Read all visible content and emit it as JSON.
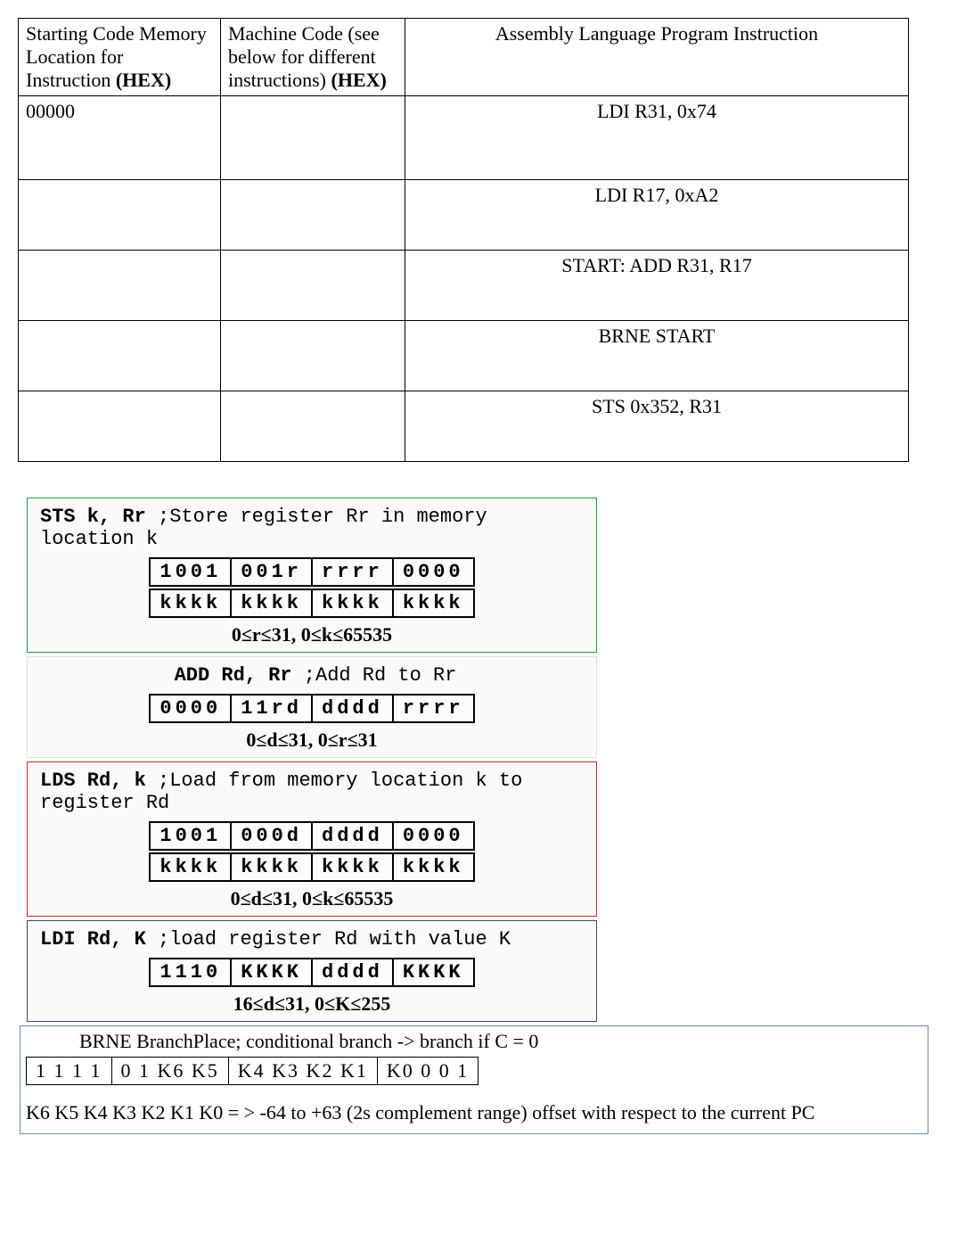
{
  "worksheet": {
    "headers": {
      "col_a": "Starting Code Memory Location for Instruction (HEX)",
      "col_a_plain": "Starting Code Memory Location for Instruction ",
      "col_a_bold": "(HEX)",
      "col_b_plain": "Machine Code (see below for different instructions) ",
      "col_b_bold": "(HEX)",
      "col_c": "Assembly Language Program Instruction"
    },
    "rows": [
      {
        "addr": "00000",
        "machine": "",
        "asm": "LDI R31, 0x74"
      },
      {
        "addr": "",
        "machine": "",
        "asm": "LDI R17, 0xA2"
      },
      {
        "addr": "",
        "machine": "",
        "asm": "START:  ADD R31, R17"
      },
      {
        "addr": "",
        "machine": "",
        "asm": "BRNE START"
      },
      {
        "addr": "",
        "machine": "",
        "asm": "STS 0x352, R31"
      }
    ]
  },
  "sts": {
    "desc_lead": "STS k, Rr",
    "desc_rest": "  ;Store register Rr in memory location k",
    "row1": [
      "1001",
      "001r",
      "rrrr",
      "0000"
    ],
    "row2": [
      "kkkk",
      "kkkk",
      "kkkk",
      "kkkk"
    ],
    "range": "0≤r≤31, 0≤k≤65535"
  },
  "add": {
    "desc_lead": "ADD Rd, Rr",
    "desc_rest": "  ;Add Rd to Rr",
    "row1": [
      "0000",
      "11rd",
      "dddd",
      "rrrr"
    ],
    "range": "0≤d≤31, 0≤r≤31"
  },
  "lds": {
    "desc_lead": "LDS Rd, k",
    "desc_rest": "  ;Load from memory location k to register Rd",
    "row1": [
      "1001",
      "000d",
      "dddd",
      "0000"
    ],
    "row2": [
      "kkkk",
      "kkkk",
      "kkkk",
      "kkkk"
    ],
    "range": "0≤d≤31, 0≤k≤65535"
  },
  "ldi": {
    "desc_lead": "LDI Rd, K",
    "desc_rest": "  ;load register Rd with value K",
    "row1": [
      "1110",
      "KKKK",
      "dddd",
      "KKKK"
    ],
    "range": "16≤d≤31, 0≤K≤255"
  },
  "brne": {
    "title": "BRNE BranchPlace; conditional branch -> branch if C = 0",
    "cells": [
      "1 1 1 1",
      "0 1 K6 K5",
      "K4 K3 K2 K1",
      "K0 0 0 1"
    ],
    "note": "K6 K5 K4 K3 K2 K1 K0 = > -64 to +63 (2s complement range) offset with respect to the current PC"
  }
}
